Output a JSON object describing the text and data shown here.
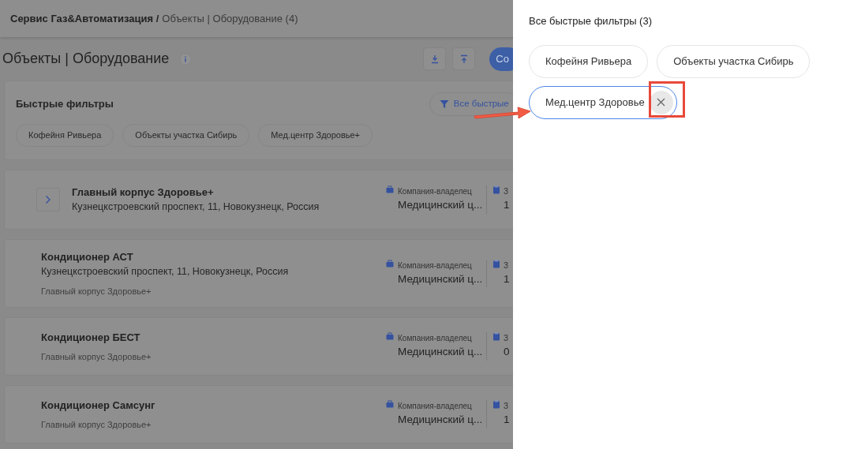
{
  "header": {
    "org": "Сервис Газ&Автоматизация /",
    "crumb": "Объекты | Оборудование (4)"
  },
  "page": {
    "title": "Объекты | Оборудование",
    "create_button": "Со"
  },
  "quick_filters": {
    "title": "Быстрые фильтры",
    "all_button": "Все быстрые",
    "chips": [
      "Кофейня Ривьера",
      "Объекты участка Сибирь",
      "Мед.центр Здоровье+"
    ]
  },
  "rows": [
    {
      "kind": "group",
      "name": "Главный корпус Здоровье+",
      "address": "Кузнецкстроевский проспект, 11, Новокузнецк, Россия",
      "fields": [
        {
          "label": "Компания-владелец",
          "value": "Медицинский ц..."
        },
        {
          "label": "З",
          "value": "1"
        }
      ]
    },
    {
      "kind": "item",
      "name": "Кондиционер АСТ",
      "address": "Кузнецкстроевский проспект, 11, Новокузнецк, Россия",
      "parent": "Главный корпус Здоровье+",
      "fields": [
        {
          "label": "Компания-владелец",
          "value": "Медицинский ц..."
        },
        {
          "label": "З",
          "value": "1"
        }
      ]
    },
    {
      "kind": "item",
      "name": "Кондиционер БЕСТ",
      "parent": "Главный корпус Здоровье+",
      "fields": [
        {
          "label": "Компания-владелец",
          "value": "Медицинский ц..."
        },
        {
          "label": "З",
          "value": "0"
        }
      ]
    },
    {
      "kind": "item",
      "name": "Кондиционер Самсунг",
      "parent": "Главный корпус Здоровье+",
      "fields": [
        {
          "label": "Компания-владелец",
          "value": "Медицинский ц..."
        },
        {
          "label": "З",
          "value": "1"
        }
      ]
    }
  ],
  "drawer": {
    "title": "Все быстрые фильтры (3)",
    "chips": [
      {
        "label": "Кофейня Ривьера",
        "selected": false
      },
      {
        "label": "Объекты участка Сибирь",
        "selected": false
      },
      {
        "label": "Мед.центр Здоровье",
        "selected": true
      }
    ]
  }
}
